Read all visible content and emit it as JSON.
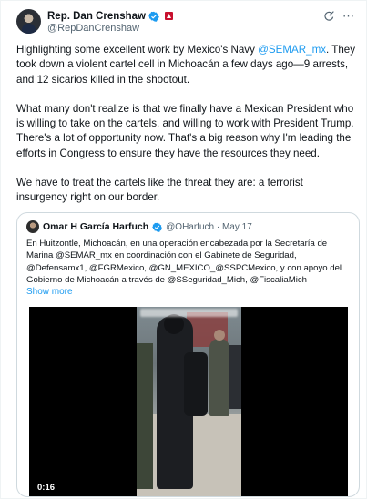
{
  "author": {
    "name": "Rep. Dan Crenshaw",
    "handle": "@RepDanCrenshaw",
    "icons": [
      "verified-badge-icon",
      "flag-badge-icon",
      "grok-icon",
      "more-options-icon"
    ]
  },
  "tweet": {
    "p1_a": "Highlighting some excellent work by Mexico's Navy ",
    "p1_mention": "@SEMAR_mx",
    "p1_b": ". They took down a violent cartel cell in Michoacán a few days ago—9 arrests, and 12 sicarios killed in the shootout.",
    "p2": "What many don't realize is that we finally have a Mexican President who is willing to take on the cartels, and willing to work with President Trump. There's a lot of opportunity now. That's a big reason why I'm leading the efforts in Congress to ensure they have the resources they need.",
    "p3": "We have to treat the cartels like the threat they are: a terrorist insurgency right on our border."
  },
  "quote": {
    "name": "Omar H García Harfuch",
    "handle": "@OHarfuch · May 17",
    "text": "En Huitzontle, Michoacán, en una operación encabezada por la Secretaría de Marina @SEMAR_mx en coordinación con el Gabinete de Seguridad, @Defensamx1, @FGRMexico, @GN_MEXICO_@SSPCMexico, y con apoyo del Gobierno de Michoacán a través de  @SSeguridad_Mich, @FiscaliaMich",
    "show_more": "Show more",
    "video_time": "0:16"
  },
  "colors": {
    "link": "#1d9bf0",
    "text": "#0f1419",
    "secondary": "#536471",
    "verified": "#1d9bf0"
  }
}
